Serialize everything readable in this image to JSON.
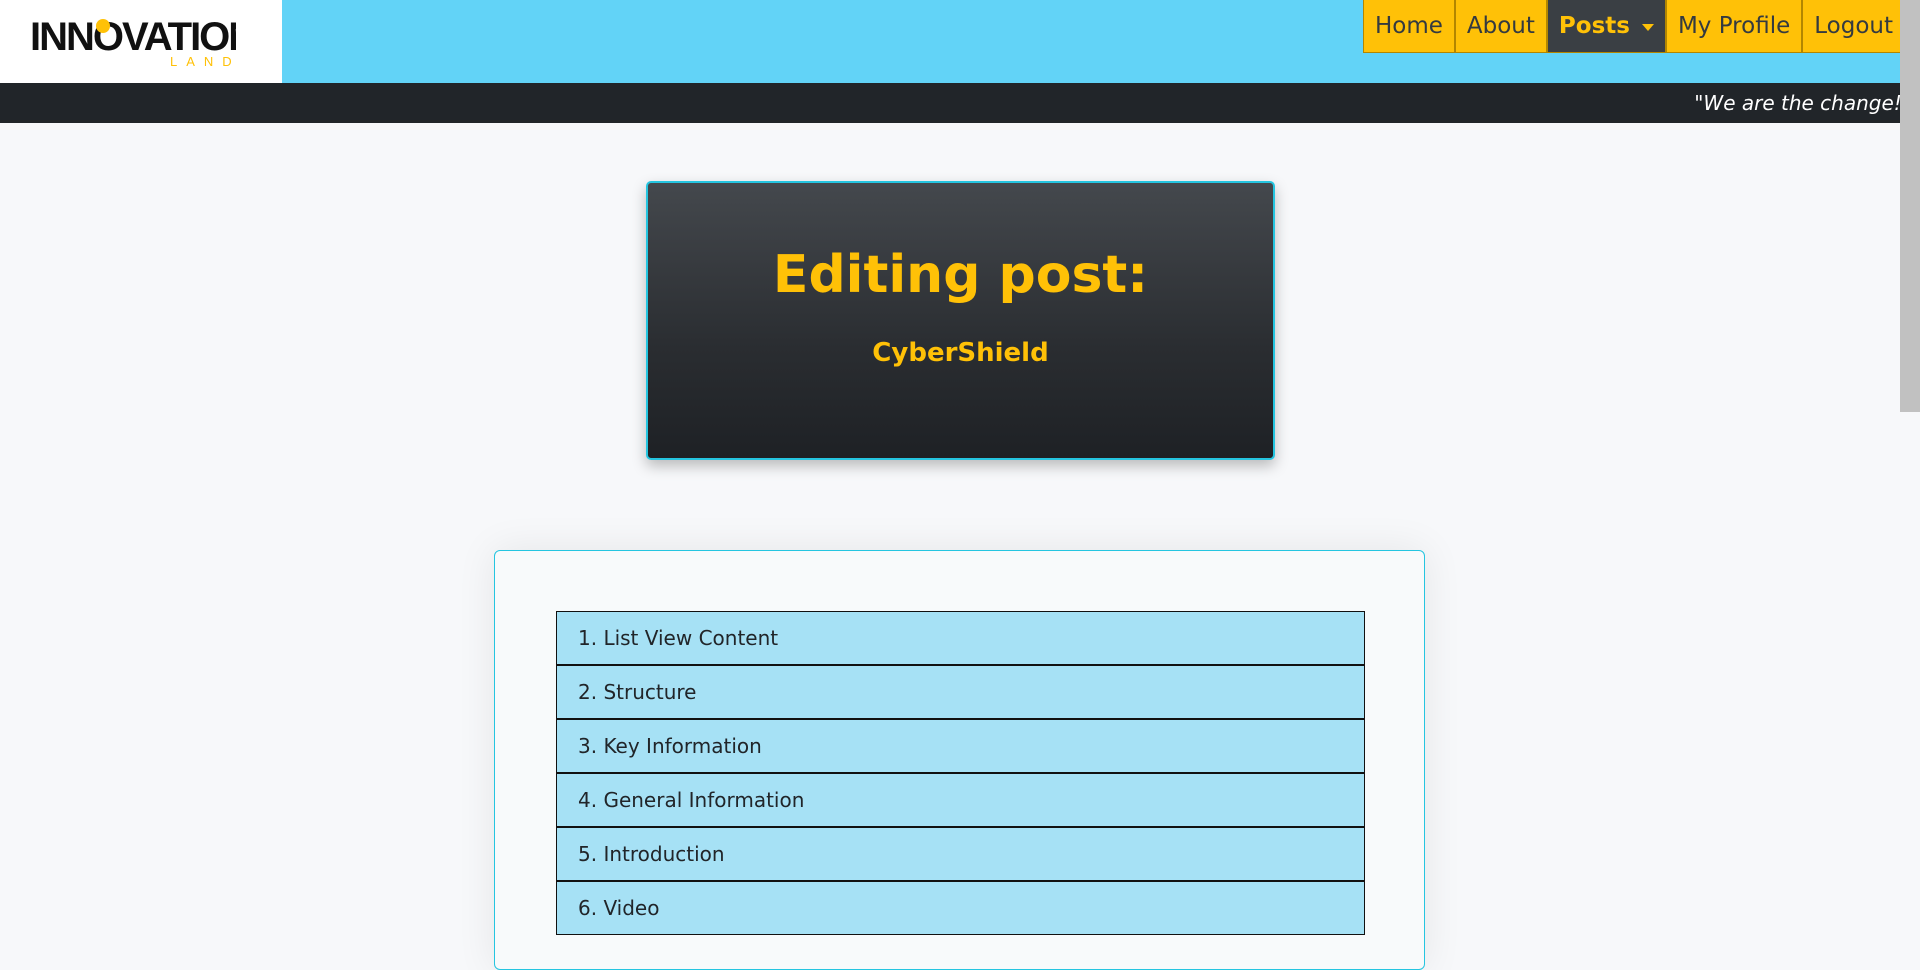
{
  "brand": {
    "logo_top": "INNOVATION",
    "logo_bottom": "LAND"
  },
  "nav": {
    "items": [
      {
        "label": "Home"
      },
      {
        "label": "About"
      },
      {
        "label": "Posts"
      },
      {
        "label": "My Profile"
      },
      {
        "label": "Logout"
      }
    ]
  },
  "tagline": "\"We are the change!\"",
  "hero": {
    "title": "Editing post:",
    "subtitle": "CyberShield"
  },
  "sections": [
    {
      "label": "1. List View Content"
    },
    {
      "label": "2. Structure"
    },
    {
      "label": "3. Key Information"
    },
    {
      "label": "4. General Information"
    },
    {
      "label": "5. Introduction"
    },
    {
      "label": "6. Video"
    }
  ],
  "colors": {
    "topbar": "#62d3f7",
    "accent": "#ffc107",
    "dark": "#212529",
    "card_border": "#25c5e0",
    "section_bg": "#a6e1f5"
  }
}
